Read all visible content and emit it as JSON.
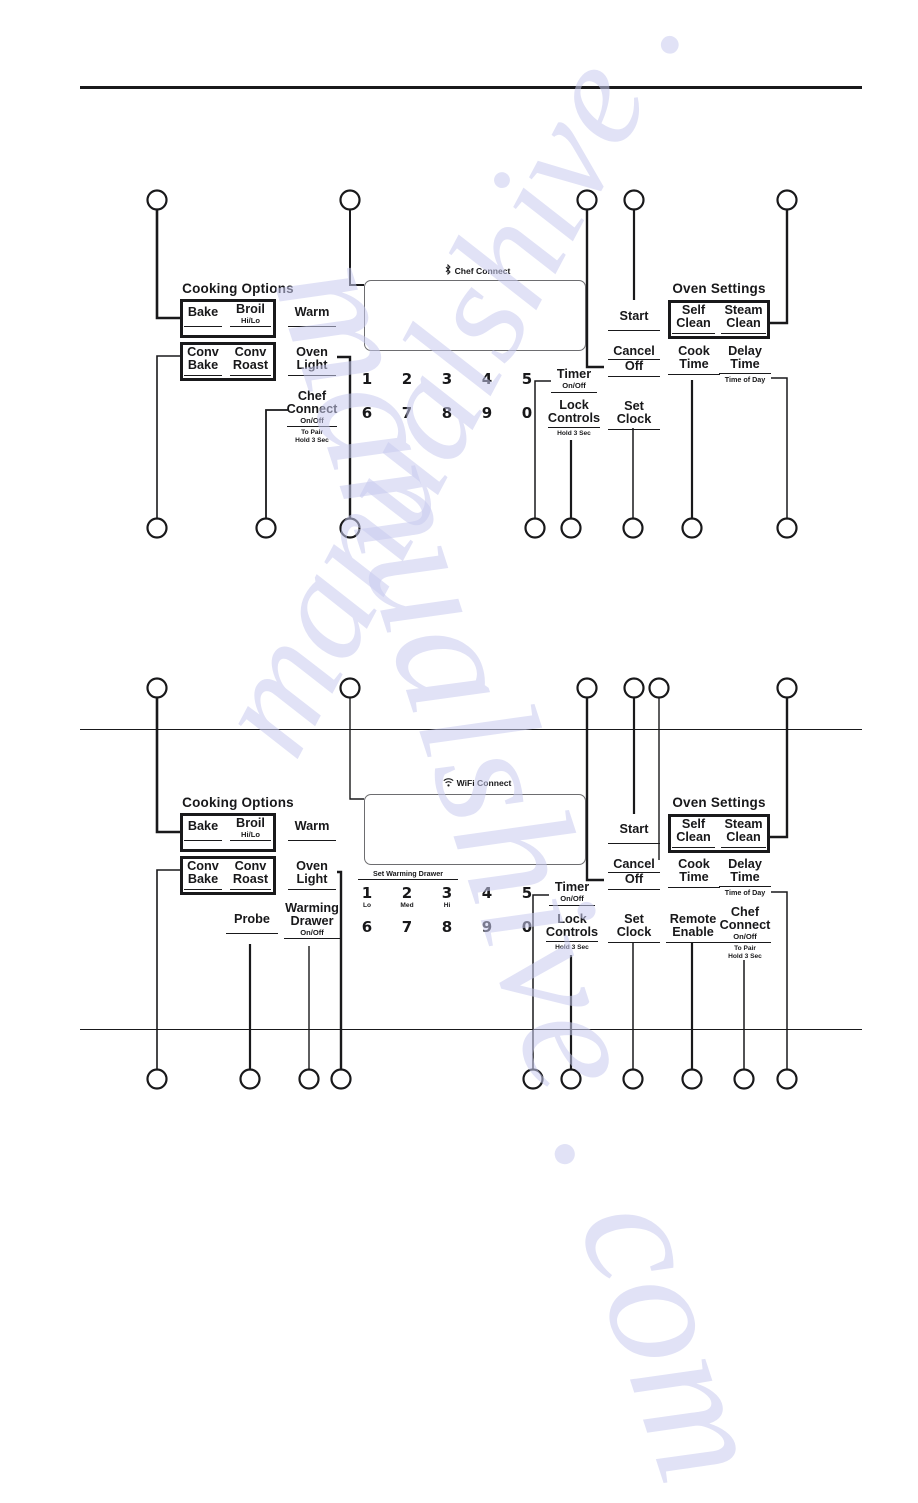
{
  "doc": {
    "watermark": "manualshive . com"
  },
  "panels": [
    {
      "id": "panel-upper",
      "connect_label": "Chef Connect",
      "connect_icon": "bluetooth-icon",
      "cooking_options_title": "Cooking Options",
      "oven_settings_title": "Oven Settings",
      "keys": {
        "bake": "Bake",
        "broil": "Broil",
        "broil_sub": "Hi/Lo",
        "conv_bake_1": "Conv",
        "conv_bake_2": "Bake",
        "conv_roast_1": "Conv",
        "conv_roast_2": "Roast",
        "warm": "Warm",
        "oven_light_1": "Oven",
        "oven_light_2": "Light",
        "chef_connect_1": "Chef",
        "chef_connect_2": "Connect",
        "chef_connect_sub": "On/Off",
        "chef_connect_sub2_a": "To Pair",
        "chef_connect_sub2_b": "Hold 3 Sec",
        "timer": "Timer",
        "timer_sub": "On/Off",
        "lock_1": "Lock",
        "lock_2": "Controls",
        "lock_sub": "Hold 3 Sec",
        "start": "Start",
        "cancel": "Cancel",
        "cancel_sub": "Off",
        "set_clock_1": "Set",
        "set_clock_2": "Clock",
        "cook_time_1": "Cook",
        "cook_time_2": "Time",
        "delay_time_1": "Delay",
        "delay_time_2": "Time",
        "delay_time_sub": "Time of Day",
        "self_clean_1": "Self",
        "self_clean_2": "Clean",
        "steam_clean_1": "Steam",
        "steam_clean_2": "Clean"
      },
      "numpad_row1": [
        "1",
        "2",
        "3",
        "4",
        "5"
      ],
      "numpad_row2": [
        "6",
        "7",
        "8",
        "9",
        "0"
      ]
    },
    {
      "id": "panel-lower",
      "connect_label": "WiFi Connect",
      "connect_icon": "wifi-icon",
      "cooking_options_title": "Cooking Options",
      "oven_settings_title": "Oven Settings",
      "set_warming_drawer": "Set Warming Drawer",
      "keys": {
        "bake": "Bake",
        "broil": "Broil",
        "broil_sub": "Hi/Lo",
        "conv_bake_1": "Conv",
        "conv_bake_2": "Bake",
        "conv_roast_1": "Conv",
        "conv_roast_2": "Roast",
        "warm": "Warm",
        "oven_light_1": "Oven",
        "oven_light_2": "Light",
        "probe": "Probe",
        "warming_drawer_1": "Warming",
        "warming_drawer_2": "Drawer",
        "warming_drawer_sub": "On/Off",
        "timer": "Timer",
        "timer_sub": "On/Off",
        "lock_1": "Lock",
        "lock_2": "Controls",
        "lock_sub": "Hold 3 Sec",
        "start": "Start",
        "cancel": "Cancel",
        "cancel_sub": "Off",
        "set_clock_1": "Set",
        "set_clock_2": "Clock",
        "cook_time_1": "Cook",
        "cook_time_2": "Time",
        "delay_time_1": "Delay",
        "delay_time_2": "Time",
        "delay_time_sub": "Time of Day",
        "remote_enable_1": "Remote",
        "remote_enable_2": "Enable",
        "chef_connect_1": "Chef",
        "chef_connect_2": "Connect",
        "chef_connect_sub": "On/Off",
        "chef_connect_sub2_a": "To Pair",
        "chef_connect_sub2_b": "Hold 3 Sec",
        "self_clean_1": "Self",
        "self_clean_2": "Clean",
        "steam_clean_1": "Steam",
        "steam_clean_2": "Clean"
      },
      "numpad_row1": [
        "1",
        "2",
        "3",
        "4",
        "5"
      ],
      "numpad_row1_subs": [
        "Lo",
        "Med",
        "Hi",
        "",
        ""
      ],
      "numpad_row2": [
        "6",
        "7",
        "8",
        "9",
        "0"
      ]
    }
  ],
  "colors": {
    "ink": "#19191b",
    "display_border": "#6d6d70",
    "watermark": "#c9cbef"
  }
}
